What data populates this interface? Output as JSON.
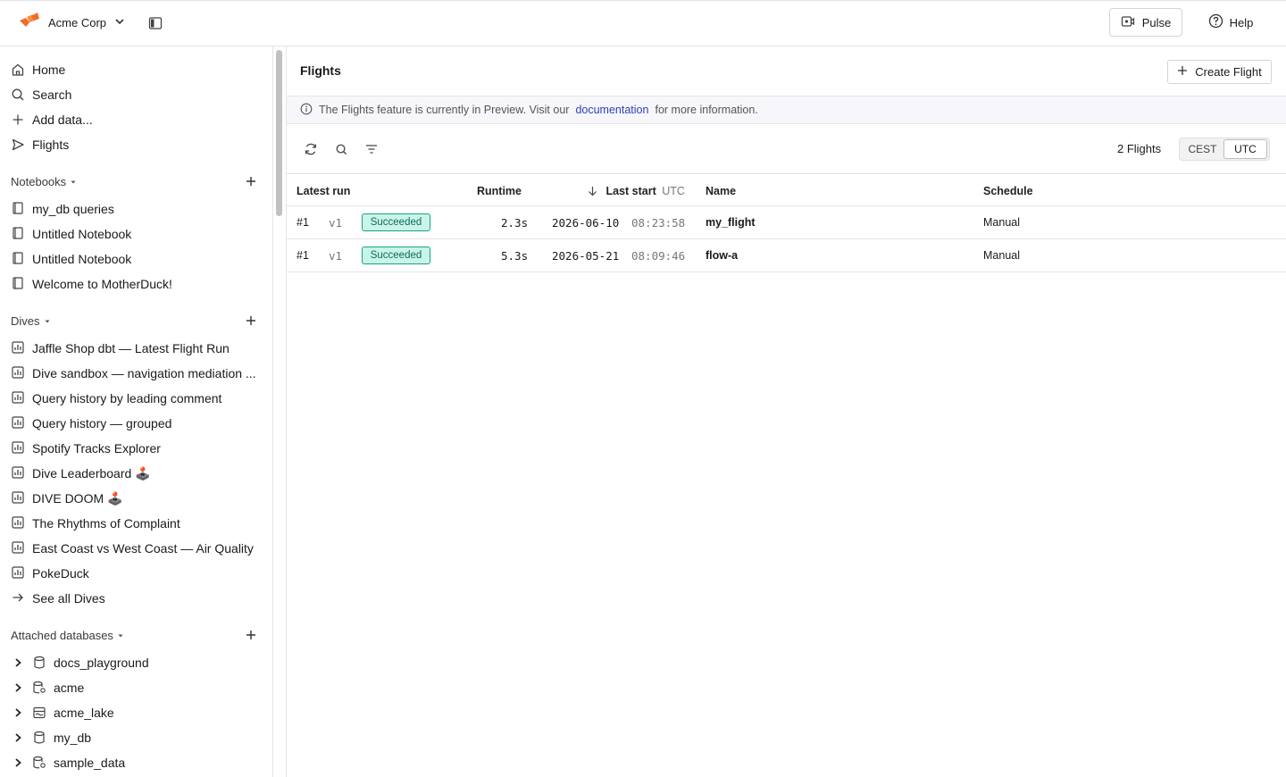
{
  "topbar": {
    "org_name": "Acme Corp",
    "pulse_label": "Pulse",
    "help_label": "Help"
  },
  "nav": {
    "items": [
      {
        "label": "Home",
        "icon": "home-icon"
      },
      {
        "label": "Search",
        "icon": "search-icon"
      },
      {
        "label": "Add data...",
        "icon": "plus-icon"
      },
      {
        "label": "Flights",
        "icon": "flights-icon"
      }
    ]
  },
  "notebooks": {
    "title": "Notebooks",
    "items": [
      "my_db queries",
      "Untitled Notebook",
      "Untitled Notebook",
      "Welcome to MotherDuck!"
    ]
  },
  "dives": {
    "title": "Dives",
    "items": [
      "Jaffle Shop dbt — Latest Flight Run",
      "Dive sandbox — navigation mediation ...",
      "Query history by leading comment",
      "Query history — grouped",
      "Spotify Tracks Explorer",
      "Dive Leaderboard 🕹️",
      "DIVE DOOM 🕹️",
      "The Rhythms of Complaint",
      "East Coast vs West Coast — Air Quality",
      "PokeDuck"
    ],
    "see_all": "See all Dives"
  },
  "databases": {
    "title": "Attached databases",
    "items": [
      {
        "name": "docs_playground",
        "icon": "database-icon"
      },
      {
        "name": "acme",
        "icon": "shared-database-icon"
      },
      {
        "name": "acme_lake",
        "icon": "lake-database-icon"
      },
      {
        "name": "my_db",
        "icon": "database-icon"
      },
      {
        "name": "sample_data",
        "icon": "shared-database-icon"
      }
    ]
  },
  "main": {
    "title": "Flights",
    "create_label": "Create Flight",
    "banner": {
      "before": "The Flights feature is currently in Preview. Visit our",
      "link": "documentation",
      "after": "for more information."
    },
    "count": "2 Flights",
    "tz_options": [
      "CEST",
      "UTC"
    ],
    "tz_selected": "UTC",
    "columns": {
      "latest_run": "Latest run",
      "runtime": "Runtime",
      "last_start": "Last start",
      "last_start_tz": "UTC",
      "name": "Name",
      "schedule": "Schedule"
    },
    "rows": [
      {
        "run": "#1",
        "version": "v1",
        "status": "Succeeded",
        "runtime": "2.3s",
        "date": "2026-06-10",
        "time": "08:23:58",
        "name": "my_flight",
        "schedule": "Manual"
      },
      {
        "run": "#1",
        "version": "v1",
        "status": "Succeeded",
        "runtime": "5.3s",
        "date": "2026-05-21",
        "time": "08:09:46",
        "name": "flow-a",
        "schedule": "Manual"
      }
    ]
  },
  "colors": {
    "accent": "#2f3fb5",
    "success_bg": "#c8f5e8",
    "success_border": "#1aa088",
    "logo": "#f26b2a"
  }
}
